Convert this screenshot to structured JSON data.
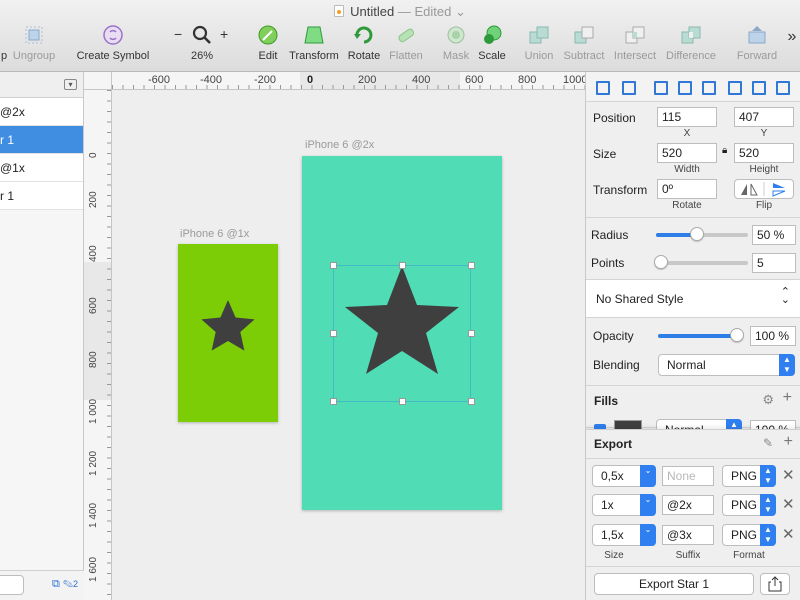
{
  "window": {
    "title": "Untitled",
    "status": "— Edited ⌄"
  },
  "toolbar": {
    "items": [
      {
        "label": "Ungroup",
        "icon": "ungroup-icon",
        "disabled": true
      },
      {
        "label": "Create Symbol",
        "icon": "create-symbol-icon",
        "disabled": false
      },
      {
        "label": "26%",
        "icon": "zoom-icon",
        "minus": "−",
        "plus": "+",
        "disabled": false
      },
      {
        "label": "Edit",
        "icon": "edit-icon",
        "disabled": false
      },
      {
        "label": "Transform",
        "icon": "transform-icon",
        "disabled": false
      },
      {
        "label": "Rotate",
        "icon": "rotate-icon",
        "disabled": false
      },
      {
        "label": "Flatten",
        "icon": "flatten-icon",
        "disabled": true
      },
      {
        "label": "Mask",
        "icon": "mask-icon",
        "disabled": true
      },
      {
        "label": "Scale",
        "icon": "scale-icon",
        "disabled": false
      },
      {
        "label": "Union",
        "icon": "union-icon",
        "disabled": true
      },
      {
        "label": "Subtract",
        "icon": "subtract-icon",
        "disabled": true
      },
      {
        "label": "Intersect",
        "icon": "intersect-icon",
        "disabled": true
      },
      {
        "label": "Difference",
        "icon": "difference-icon",
        "disabled": true
      },
      {
        "label": "Forward",
        "icon": "forward-icon",
        "disabled": true
      }
    ],
    "group_left_partial": "p",
    "overflow": "»"
  },
  "layers": {
    "collapse_glyph": "▾",
    "rows": [
      {
        "label": "@2x",
        "selected": false
      },
      {
        "label": "r 1",
        "selected": true
      },
      {
        "label": "@1x",
        "selected": false
      },
      {
        "label": "r 1",
        "selected": false
      }
    ],
    "footer_count": "2"
  },
  "rulers": {
    "top": [
      "-600",
      "-400",
      "-200",
      "0",
      "200",
      "400",
      "600",
      "800",
      "1000"
    ],
    "left": [
      "0",
      "200",
      "400",
      "600",
      "800",
      "1 000",
      "1 200",
      "1 400",
      "1 600"
    ]
  },
  "canvas": {
    "artboards": [
      {
        "name": "iPhone 6 @1x",
        "color": "#7ccd06"
      },
      {
        "name": "iPhone 6 @2x",
        "color": "#50ddb5"
      }
    ],
    "star_color": "#3f3f3f"
  },
  "inspector": {
    "position": {
      "label": "Position",
      "x": "115",
      "y": "407",
      "x_label": "X",
      "y_label": "Y"
    },
    "size": {
      "label": "Size",
      "width": "520",
      "height": "520",
      "width_label": "Width",
      "height_label": "Height"
    },
    "transform": {
      "label": "Transform",
      "rotate": "0º",
      "rotate_label": "Rotate",
      "flip_label": "Flip"
    },
    "radius": {
      "label": "Radius",
      "value": "50 %",
      "level": 0.45
    },
    "points": {
      "label": "Points",
      "value": "5",
      "level": 0.05
    },
    "shared_style": "No Shared Style",
    "opacity": {
      "label": "Opacity",
      "value": "100 %",
      "level": 1.0
    },
    "blending": {
      "label": "Blending",
      "value": "Normal"
    },
    "fills": {
      "label": "Fills",
      "blend": "Normal",
      "opacity": "100 %"
    },
    "export": {
      "label": "Export",
      "rows": [
        {
          "scale": "0,5x",
          "suffix": "",
          "suffix_placeholder": "None",
          "format": "PNG"
        },
        {
          "scale": "1x",
          "suffix": "@2x",
          "suffix_placeholder": "",
          "format": "PNG"
        },
        {
          "scale": "1,5x",
          "suffix": "@3x",
          "suffix_placeholder": "",
          "format": "PNG"
        }
      ],
      "col_size": "Size",
      "col_suffix": "Suffix",
      "col_format": "Format",
      "button": "Export Star 1"
    },
    "accent": "#2f7ff0"
  }
}
